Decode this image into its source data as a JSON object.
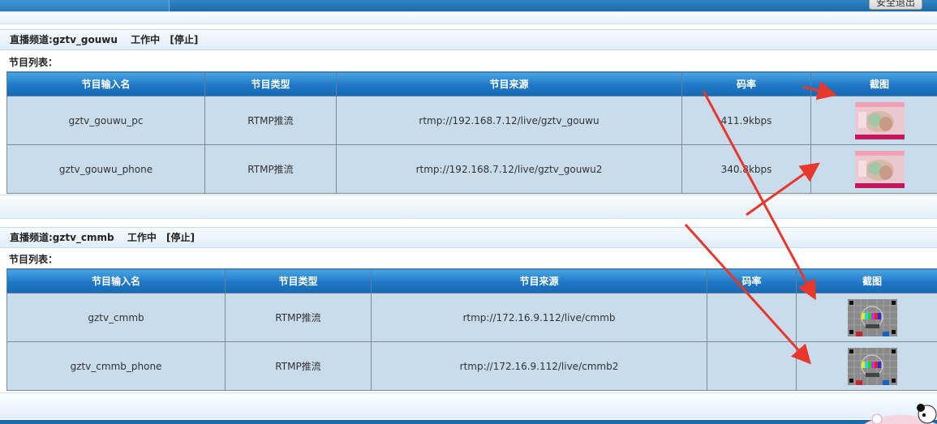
{
  "header": {
    "logout_label": "安全退出"
  },
  "channels": [
    {
      "channel_label": "直播频道:gztv_gouwu",
      "status": "工作中",
      "stop_label": "[停止]",
      "list_label": "节目列表：",
      "columns": [
        "节目输入名",
        "节目类型",
        "节目来源",
        "码率",
        "截图"
      ],
      "rows": [
        {
          "name": "gztv_gouwu_pc",
          "type": "RTMP推流",
          "source": "rtmp://192.168.7.12/live/gztv_gouwu",
          "bitrate": "411.9kbps",
          "thumb": "shopping-thumbnail"
        },
        {
          "name": "gztv_gouwu_phone",
          "type": "RTMP推流",
          "source": "rtmp://192.168.7.12/live/gztv_gouwu2",
          "bitrate": "340.8kbps",
          "thumb": "shopping-thumbnail"
        }
      ]
    },
    {
      "channel_label": "直播频道:gztv_cmmb",
      "status": "工作中",
      "stop_label": "[停止]",
      "list_label": "节目列表：",
      "columns": [
        "节目输入名",
        "节目类型",
        "节目来源",
        "码率",
        "截图"
      ],
      "rows": [
        {
          "name": "gztv_cmmb",
          "type": "RTMP推流",
          "source": "rtmp://172.16.9.112/live/cmmb",
          "bitrate": "",
          "thumb": "test-card-thumbnail"
        },
        {
          "name": "gztv_cmmb_phone",
          "type": "RTMP推流",
          "source": "rtmp://172.16.9.112/live/cmmb2",
          "bitrate": "",
          "thumb": "test-card-thumbnail"
        }
      ]
    }
  ],
  "colors": {
    "header_blue": "#1f78c5",
    "row_bg": "#c8dcec",
    "annotation_red": "#e8372c"
  }
}
